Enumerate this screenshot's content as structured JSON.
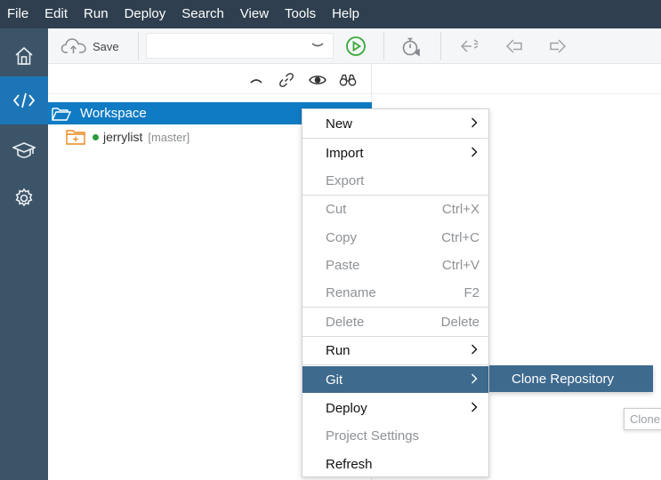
{
  "menubar": {
    "items": [
      "File",
      "Edit",
      "Run",
      "Deploy",
      "Search",
      "View",
      "Tools",
      "Help"
    ]
  },
  "activity": {
    "items": [
      {
        "icon": "home-icon"
      },
      {
        "icon": "code-icon",
        "active": true
      },
      {
        "icon": "graduation-cap-icon"
      },
      {
        "icon": "gear-icon"
      }
    ]
  },
  "toolbar": {
    "save_label": "Save",
    "run_config_value": ""
  },
  "explorer": {
    "workspace_label": "Workspace",
    "project": {
      "name": "jerrylist",
      "branch": "[master]"
    }
  },
  "context_menu": {
    "new": "New",
    "import": "Import",
    "export": "Export",
    "cut": "Cut",
    "cut_shortcut": "Ctrl+X",
    "copy": "Copy",
    "copy_shortcut": "Ctrl+C",
    "paste": "Paste",
    "paste_shortcut": "Ctrl+V",
    "rename": "Rename",
    "rename_shortcut": "F2",
    "delete": "Delete",
    "delete_shortcut": "Delete",
    "run": "Run",
    "git": "Git",
    "deploy": "Deploy",
    "project_settings": "Project Settings",
    "refresh": "Refresh"
  },
  "git_submenu": {
    "clone_repository": "Clone Repository"
  },
  "tooltip": {
    "text": "Clone"
  },
  "colors": {
    "menubar_bg": "#2f3f4f",
    "activity_bg": "#3c5468",
    "activity_active": "#1c75b7",
    "selection": "#0f7bc4",
    "menu_highlight": "#3e6a8e",
    "run_green": "#3aa83a"
  }
}
